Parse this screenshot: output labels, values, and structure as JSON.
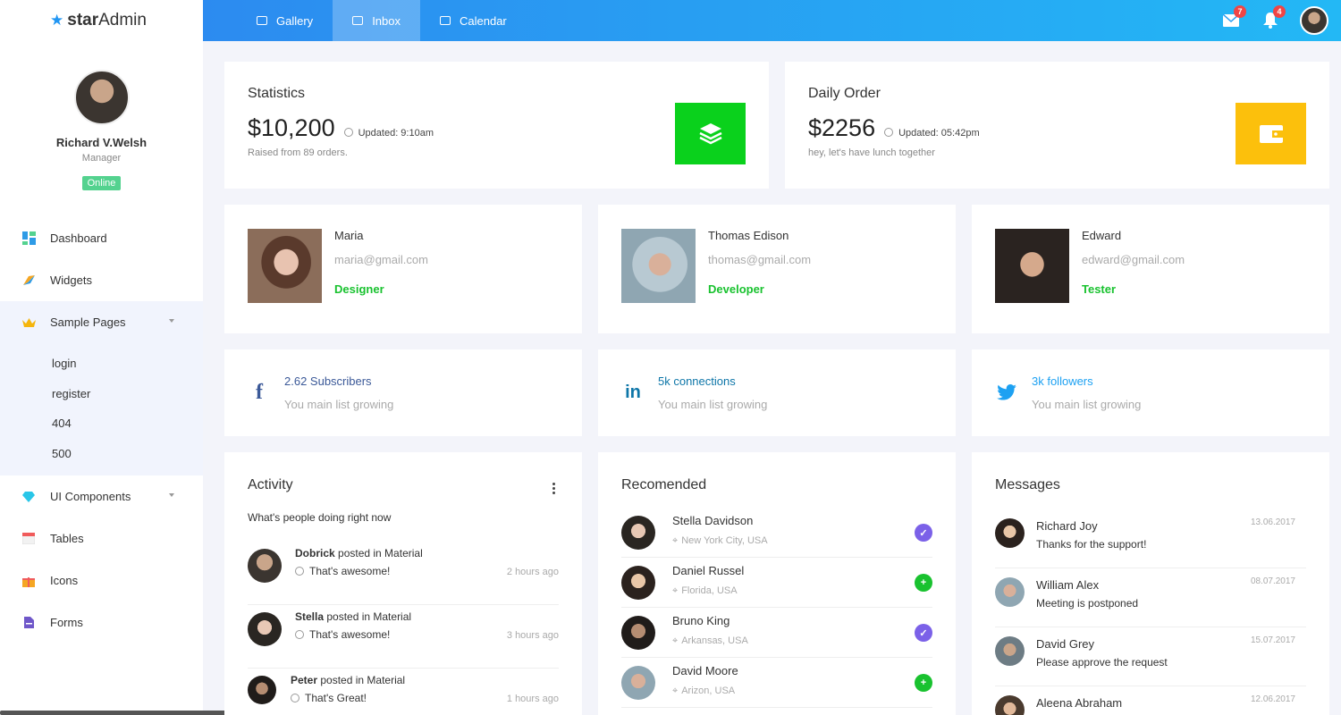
{
  "brand": {
    "name_bold": "star",
    "name_rest": "Admin"
  },
  "profile": {
    "name": "Richard V.Welsh",
    "role": "Manager",
    "status": "Online"
  },
  "nav": {
    "items": [
      {
        "label": "Dashboard"
      },
      {
        "label": "Widgets"
      },
      {
        "label": "Sample Pages"
      },
      {
        "label": "UI Components"
      },
      {
        "label": "Tables"
      },
      {
        "label": "Icons"
      },
      {
        "label": "Forms"
      }
    ],
    "sub": [
      "login",
      "register",
      "404",
      "500"
    ]
  },
  "topbar": {
    "tabs": [
      {
        "label": "Gallery"
      },
      {
        "label": "Inbox"
      },
      {
        "label": "Calendar"
      }
    ],
    "mail_count": "7",
    "notif_count": "4"
  },
  "stats": [
    {
      "title": "Statistics",
      "amount": "$10,200",
      "updated": "Updated: 9:10am",
      "sub": "Raised from 89 orders.",
      "color": "#0ad11c"
    },
    {
      "title": "Daily Order",
      "amount": "$2256",
      "updated": "Updated: 05:42pm",
      "sub": "hey, let's have lunch together",
      "color": "#fcc00c"
    }
  ],
  "people": [
    {
      "name": "Maria",
      "email": "maria@gmail.com",
      "role": "Designer"
    },
    {
      "name": "Thomas Edison",
      "email": "thomas@gmail.com",
      "role": "Developer"
    },
    {
      "name": "Edward",
      "email": "edward@gmail.com",
      "role": "Tester"
    }
  ],
  "social": [
    {
      "count": "2.62 Subscribers",
      "sub": "You main list growing",
      "color": "#3b5998",
      "icon": "facebook-icon"
    },
    {
      "count": "5k connections",
      "sub": "You main list growing",
      "color": "#0e76a8",
      "icon": "linkedin-icon"
    },
    {
      "count": "3k followers",
      "sub": "You main list growing",
      "color": "#1da1f2",
      "icon": "twitter-icon"
    }
  ],
  "activity": {
    "title": "Activity",
    "subtitle": "What's people doing right now",
    "items": [
      {
        "name": "Dobrick",
        "action": " posted in Material",
        "text": "That's awesome!",
        "time": "2 hours ago"
      },
      {
        "name": "Stella",
        "action": " posted in Material",
        "text": "That's awesome!",
        "time": "3 hours ago"
      },
      {
        "name": "Peter",
        "action": " posted in Material",
        "text": "That's Great!",
        "time": "1 hours ago"
      }
    ]
  },
  "recommended": {
    "title": "Recomended",
    "items": [
      {
        "name": "Stella Davidson",
        "location": "New York City, USA",
        "status": "check",
        "color": "#7b61e8"
      },
      {
        "name": "Daniel Russel",
        "location": "Florida, USA",
        "status": "plus",
        "color": "#19c22f"
      },
      {
        "name": "Bruno King",
        "location": "Arkansas, USA",
        "status": "check",
        "color": "#7b61e8"
      },
      {
        "name": "David Moore",
        "location": "Arizon, USA",
        "status": "plus",
        "color": "#19c22f"
      }
    ]
  },
  "messages": {
    "title": "Messages",
    "items": [
      {
        "name": "Richard Joy",
        "text": "Thanks for the support!",
        "date": "13.06.2017"
      },
      {
        "name": "William Alex",
        "text": "Meeting is postponed",
        "date": "08.07.2017"
      },
      {
        "name": "David Grey",
        "text": "Please approve the request",
        "date": "15.07.2017"
      },
      {
        "name": "Aleena Abraham",
        "text": "",
        "date": "12.06.2017"
      }
    ]
  }
}
